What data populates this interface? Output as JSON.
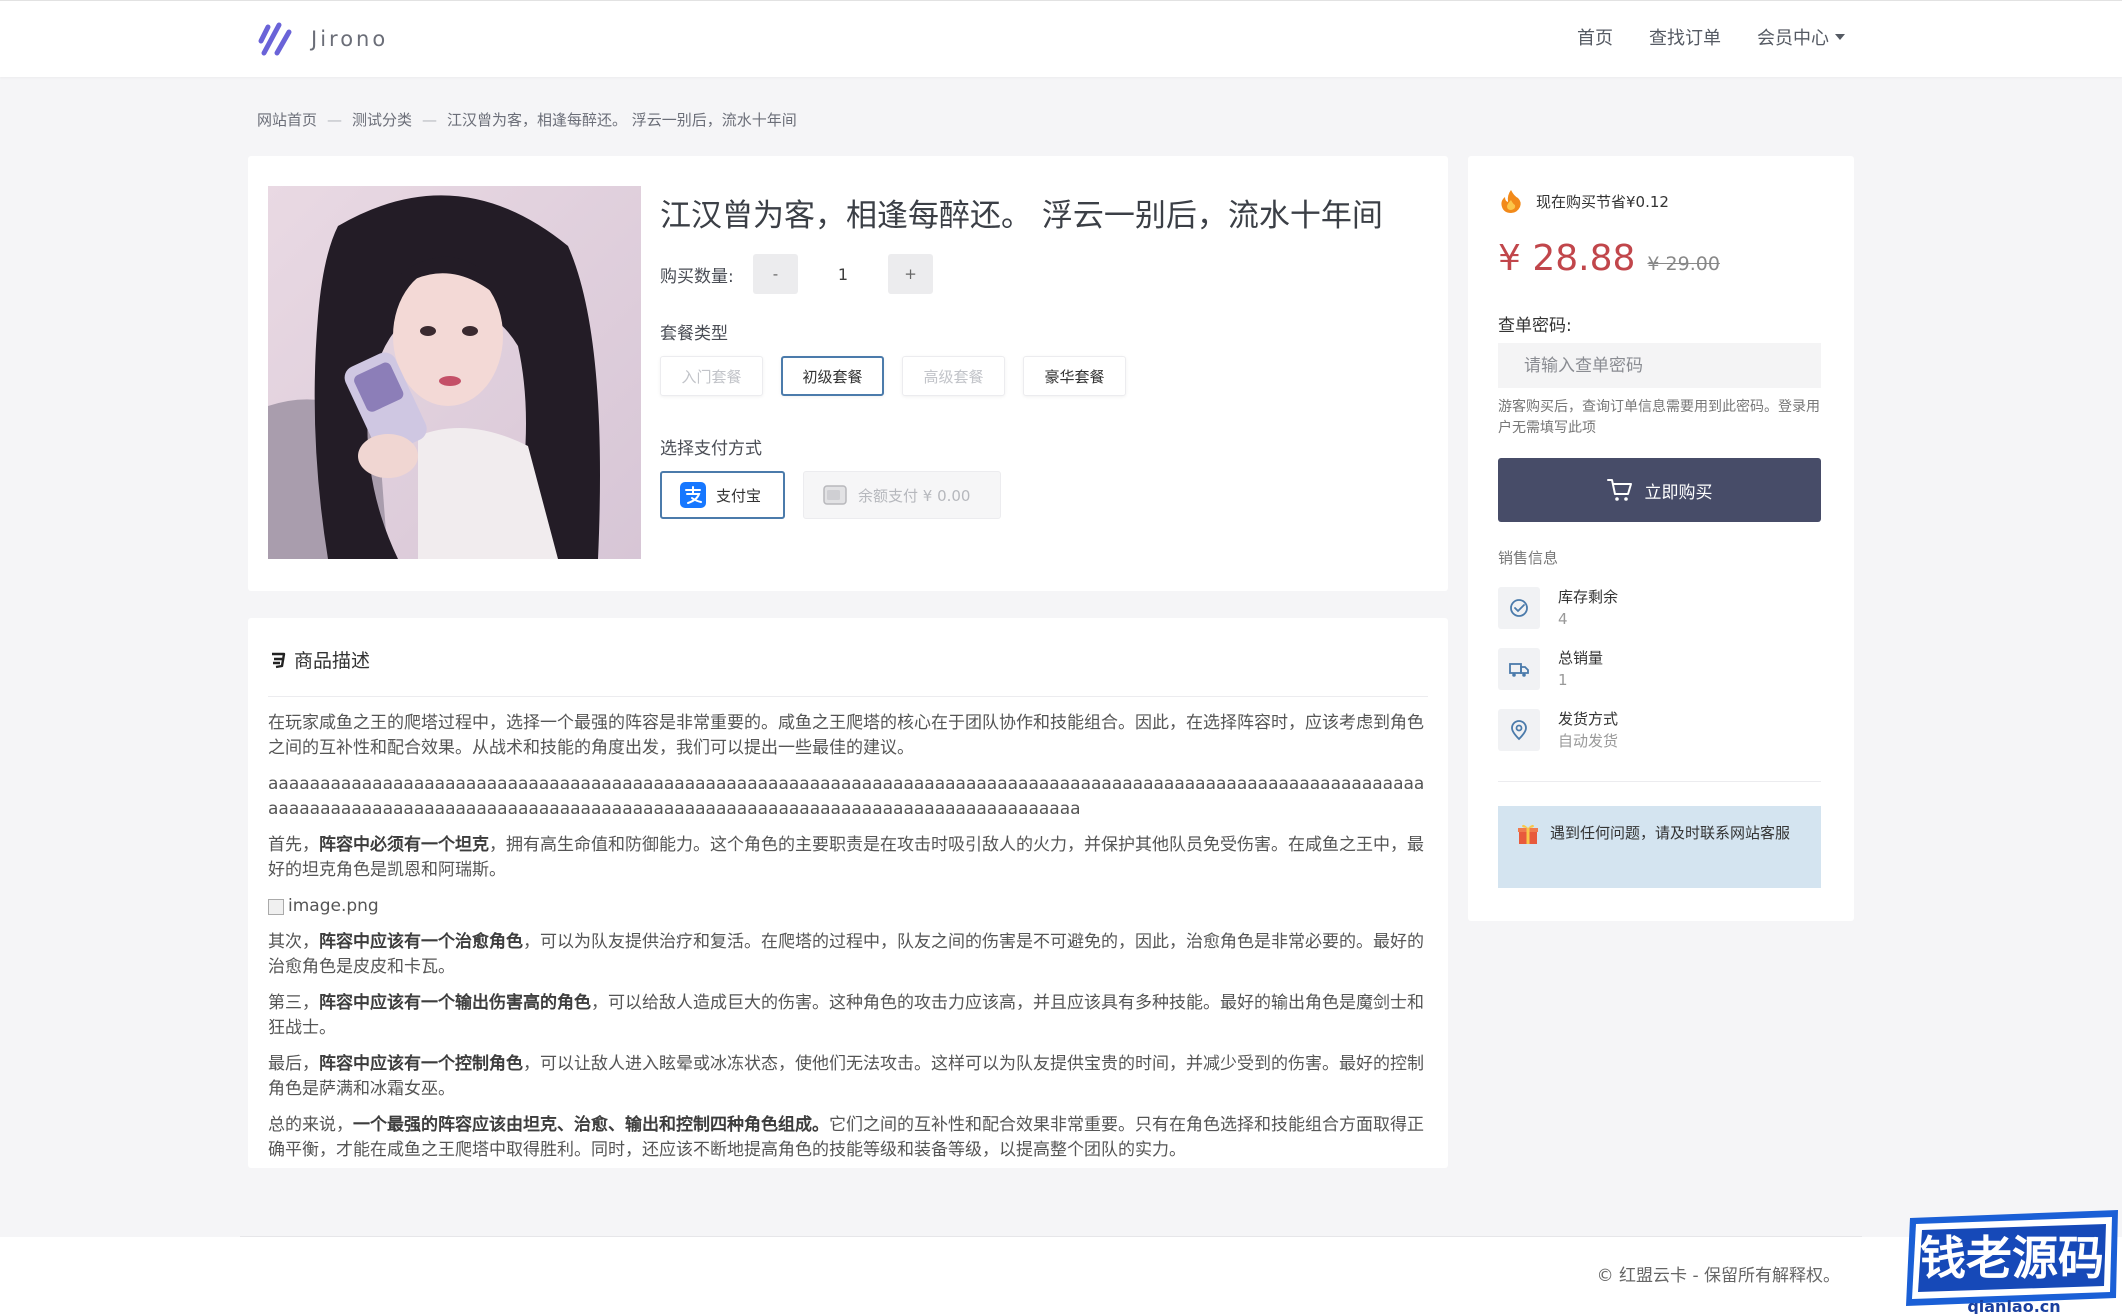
{
  "header": {
    "logo_text": "Jirono",
    "nav": {
      "home": "首页",
      "find_order": "查找订单",
      "member": "会员中心"
    }
  },
  "breadcrumb": {
    "items": [
      "网站首页",
      "测试分类",
      "江汉曾为客，相逢每醉还。 浮云一别后，流水十年间"
    ],
    "separator": "—"
  },
  "product": {
    "title": "江汉曾为客，相逢每醉还。 浮云一别后，流水十年间",
    "qty_label": "购买数量:",
    "qty_minus": "-",
    "qty_value": "1",
    "qty_plus": "+",
    "package_label": "套餐类型",
    "packages": [
      "入门套餐",
      "初级套餐",
      "高级套餐",
      "豪华套餐"
    ],
    "payment_label": "选择支付方式",
    "pay_alipay": "支付宝",
    "pay_balance": "余额支付 ¥ 0.00"
  },
  "description": {
    "title": "商品描述",
    "p1": "在玩家咸鱼之王的爬塔过程中，选择一个最强的阵容是非常重要的。咸鱼之王爬塔的核心在于团队协作和技能组合。因此，在选择阵容时，应该考虑到角色之间的互补性和配合效果。从战术和技能的角度出发，我们可以提出一些最佳的建议。",
    "p2": "aaaaaaaaaaaaaaaaaaaaaaaaaaaaaaaaaaaaaaaaaaaaaaaaaaaaaaaaaaaaaaaaaaaaaaaaaaaaaaaaaaaaaaaaaaaaaaaaaaaaaaaaaaaaaaaaaaaaaaaaaaaaaaaaaaaaaaaaaaaaaaaaaaaaaaaaaaaaaaaaaaaaaaaaaaaaaaaaaaaaaaaaaaaaa",
    "p3_a": "首先，",
    "p3_b": "阵容中必须有一个坦克",
    "p3_c": "，拥有高生命值和防御能力。这个角色的主要职责是在攻击时吸引敌人的火力，并保护其他队员免受伤害。在咸鱼之王中，最好的坦克角色是凯恩和阿瑞斯。",
    "image_alt": "image.png",
    "p4_a": "其次，",
    "p4_b": "阵容中应该有一个治愈角色",
    "p4_c": "，可以为队友提供治疗和复活。在爬塔的过程中，队友之间的伤害是不可避免的，因此，治愈角色是非常必要的。最好的治愈角色是皮皮和卡瓦。",
    "p5_a": "第三，",
    "p5_b": "阵容中应该有一个输出伤害高的角色",
    "p5_c": "，可以给敌人造成巨大的伤害。这种角色的攻击力应该高，并且应该具有多种技能。最好的输出角色是魔剑士和狂战士。",
    "p6_a": "最后，",
    "p6_b": "阵容中应该有一个控制角色",
    "p6_c": "，可以让敌人进入眩晕或冰冻状态，使他们无法攻击。这样可以为队友提供宝贵的时间，并减少受到的伤害。最好的控制角色是萨满和冰霜女巫。",
    "p7_a": "总的来说，",
    "p7_b": "一个最强的阵容应该由坦克、治愈、输出和控制四种角色组成。",
    "p7_c": "它们之间的互补性和配合效果非常重要。只有在角色选择和技能组合方面取得正确平衡，才能在咸鱼之王爬塔中取得胜利。同时，还应该不断地提高角色的技能等级和装备等级，以提高整个团队的实力。"
  },
  "sidebar": {
    "save_text": "现在购买节省¥0.12",
    "price_now": "¥ 28.88",
    "price_old": "¥ 29.00",
    "password_label": "查单密码:",
    "password_placeholder": "请输入查单密码",
    "password_hint": "游客购买后，查询订单信息需要用到此密码。登录用户无需填写此项",
    "buy_button": "立即购买",
    "sales_label": "销售信息",
    "stock_label": "库存剩余",
    "stock_value": "4",
    "sold_label": "总销量",
    "sold_value": "1",
    "delivery_label": "发货方式",
    "delivery_value": "自动发货",
    "notice": "遇到任何问题，请及时联系网站客服"
  },
  "footer": {
    "text": "© 红盟云卡 - 保留所有解释权。"
  },
  "watermark": {
    "text": "钱老源码",
    "domain": "qianlao.cn"
  },
  "colors": {
    "accent": "#4b7bab",
    "buy_button": "#474c68",
    "price": "#c1464b",
    "notice_bg": "#d4e4f0"
  }
}
